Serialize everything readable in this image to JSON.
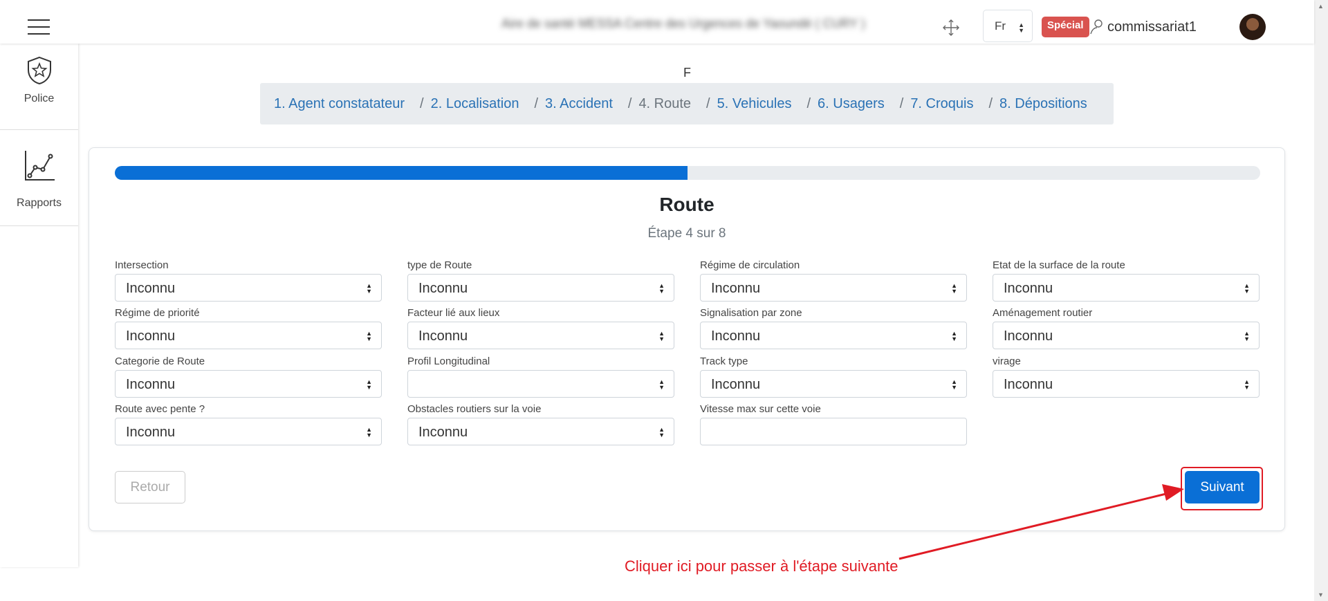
{
  "header": {
    "site_name": "Aire de santé MESSA Centre des Urgences de Yaoundé ( CURY )",
    "language": "Fr",
    "badge": "Spécial",
    "username": "commissariat1"
  },
  "sidebar": {
    "items": [
      {
        "label": "Police",
        "icon": "police-badge-icon"
      },
      {
        "label": "Rapports",
        "icon": "line-chart-icon"
      }
    ]
  },
  "page_letter": "F",
  "breadcrumb": [
    {
      "label": "1. Agent constatateur"
    },
    {
      "label": "2. Localisation"
    },
    {
      "label": "3. Accident"
    },
    {
      "label": "4. Route"
    },
    {
      "label": "5. Vehicules"
    },
    {
      "label": "6. Usagers"
    },
    {
      "label": "7. Croquis"
    },
    {
      "label": "8. Dépositions"
    }
  ],
  "form": {
    "progress_fraction": 0.5,
    "title": "Route",
    "subtitle": "Étape 4 sur 8",
    "fields": [
      {
        "label": "Intersection",
        "value": "Inconnu"
      },
      {
        "label": "type de Route",
        "value": "Inconnu"
      },
      {
        "label": "Régime de circulation",
        "value": "Inconnu"
      },
      {
        "label": "Etat de la surface de la route",
        "value": "Inconnu"
      },
      {
        "label": "Régime de priorité",
        "value": "Inconnu"
      },
      {
        "label": "Facteur lié aux lieux",
        "value": "Inconnu"
      },
      {
        "label": "Signalisation par zone",
        "value": "Inconnu"
      },
      {
        "label": "Aménagement routier",
        "value": "Inconnu"
      },
      {
        "label": "Categorie de Route",
        "value": "Inconnu"
      },
      {
        "label": "Profil Longitudinal",
        "value": ""
      },
      {
        "label": "Track type",
        "value": "Inconnu"
      },
      {
        "label": "virage",
        "value": "Inconnu"
      },
      {
        "label": "Route avec pente ?",
        "value": "Inconnu"
      },
      {
        "label": "Obstacles routiers sur la voie",
        "value": "Inconnu"
      },
      {
        "label": "Vitesse max sur cette voie",
        "value": ""
      }
    ],
    "back_label": "Retour",
    "next_label": "Suivant"
  },
  "annotation": {
    "text": "Cliquer ici pour passer à l'étape suivante",
    "color": "#e01b24"
  },
  "colors": {
    "primary": "#0a6fd6",
    "link": "#2a72b5",
    "badge": "#d9534f"
  }
}
